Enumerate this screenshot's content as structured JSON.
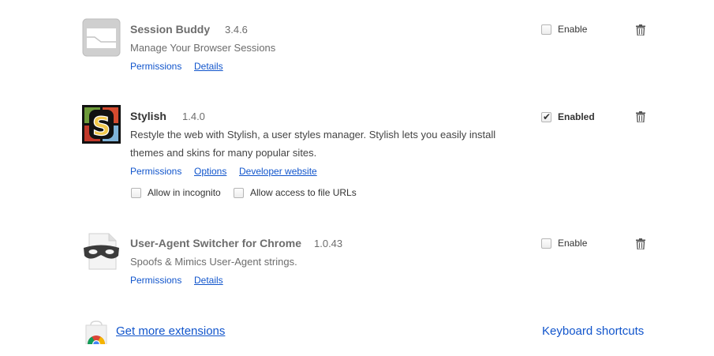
{
  "extensions": [
    {
      "name": "Session Buddy",
      "version": "3.4.6",
      "description": "Manage Your Browser Sessions",
      "links": [
        "Permissions",
        "Details"
      ],
      "enable_label": "Enable",
      "enabled": false,
      "icon": "session-buddy-icon"
    },
    {
      "name": "Stylish",
      "version": "1.4.0",
      "description": "Restyle the web with Stylish, a user styles manager. Stylish lets you easily install themes and skins for many popular sites.",
      "links": [
        "Permissions",
        "Options",
        "Developer website"
      ],
      "options": [
        "Allow in incognito",
        "Allow access to file URLs"
      ],
      "enable_label": "Enabled",
      "enabled": true,
      "icon": "stylish-icon"
    },
    {
      "name": "User-Agent Switcher for Chrome",
      "version": "1.0.43",
      "description": "Spoofs & Mimics User-Agent strings.",
      "links": [
        "Permissions",
        "Details"
      ],
      "enable_label": "Enable",
      "enabled": false,
      "icon": "user-agent-switcher-icon"
    }
  ],
  "footer": {
    "get_more": "Get more extensions",
    "keyboard_shortcuts": "Keyboard shortcuts",
    "icon": "chrome-web-store-icon"
  },
  "colors": {
    "link": "#1155cc",
    "text": "#333333",
    "muted": "#6d6d6d"
  }
}
